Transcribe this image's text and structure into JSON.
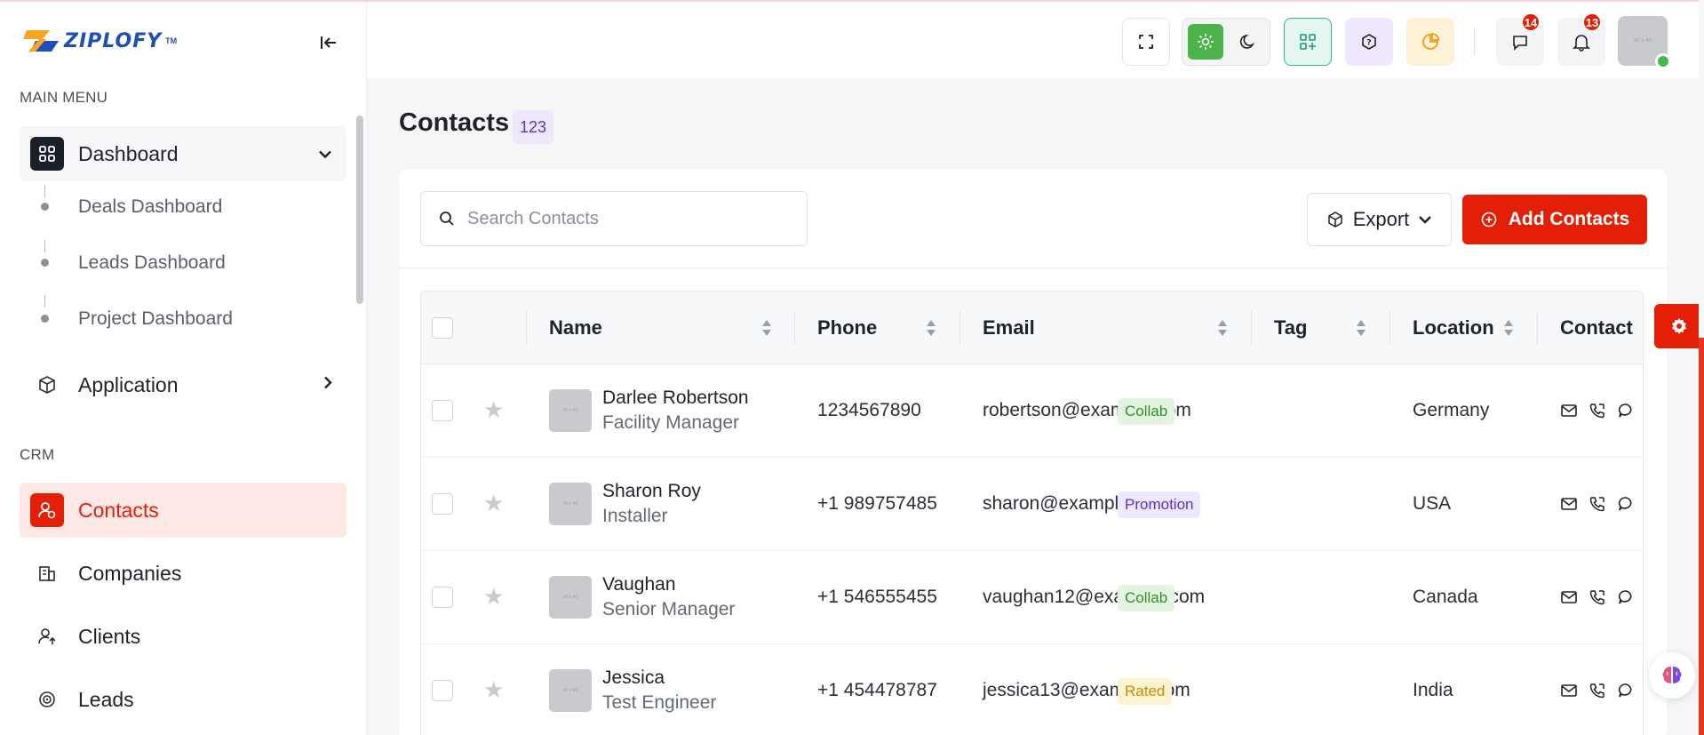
{
  "app": {
    "name": "ZIPLOFY",
    "trademark": "TM"
  },
  "sidebar": {
    "main_menu_title": "MAIN MENU",
    "crm_title": "CRM",
    "dashboard": {
      "label": "Dashboard",
      "subitems": [
        "Deals Dashboard",
        "Leads Dashboard",
        "Project Dashboard"
      ]
    },
    "application": {
      "label": "Application"
    },
    "crm_items": [
      {
        "label": "Contacts",
        "icon": "contact-icon",
        "active": true
      },
      {
        "label": "Companies",
        "icon": "building-icon",
        "active": false
      },
      {
        "label": "Clients",
        "icon": "user-up-icon",
        "active": false
      },
      {
        "label": "Leads",
        "icon": "target-icon",
        "active": false
      }
    ]
  },
  "header": {
    "notifications_count": "14",
    "alerts_count": "13",
    "avatar_placeholder": "40 x 40"
  },
  "page": {
    "title": "Contacts",
    "count": "123"
  },
  "toolbar": {
    "search_placeholder": "Search Contacts",
    "export_label": "Export",
    "add_label": "Add Contacts"
  },
  "table": {
    "columns": [
      "Name",
      "Phone",
      "Email",
      "Tag",
      "Location",
      "Contact"
    ],
    "avatar_placeholder": "40 x 40",
    "rows": [
      {
        "name": "Darlee Robertson",
        "role": "Facility Manager",
        "phone": "1234567890",
        "email": "robertson@example.com",
        "tag": "Collab",
        "tag_type": "collab",
        "location": "Germany"
      },
      {
        "name": "Sharon Roy",
        "role": "Installer",
        "phone": "+1 989757485",
        "email": "sharon@example.com",
        "tag": "Promotion",
        "tag_type": "promotion",
        "location": "USA"
      },
      {
        "name": "Vaughan",
        "role": "Senior Manager",
        "phone": "+1 546555455",
        "email": "vaughan12@example.com",
        "tag": "Collab",
        "tag_type": "collab",
        "location": "Canada"
      },
      {
        "name": "Jessica",
        "role": "Test Engineer",
        "phone": "+1 454478787",
        "email": "jessica13@example.com",
        "tag": "Rated",
        "tag_type": "rated",
        "location": "India"
      }
    ]
  },
  "colors": {
    "brand_red": "#e41f07",
    "collab_bg": "#e3f5e1",
    "promotion_bg": "#efe8fd",
    "rated_bg": "#fdf3d3"
  }
}
